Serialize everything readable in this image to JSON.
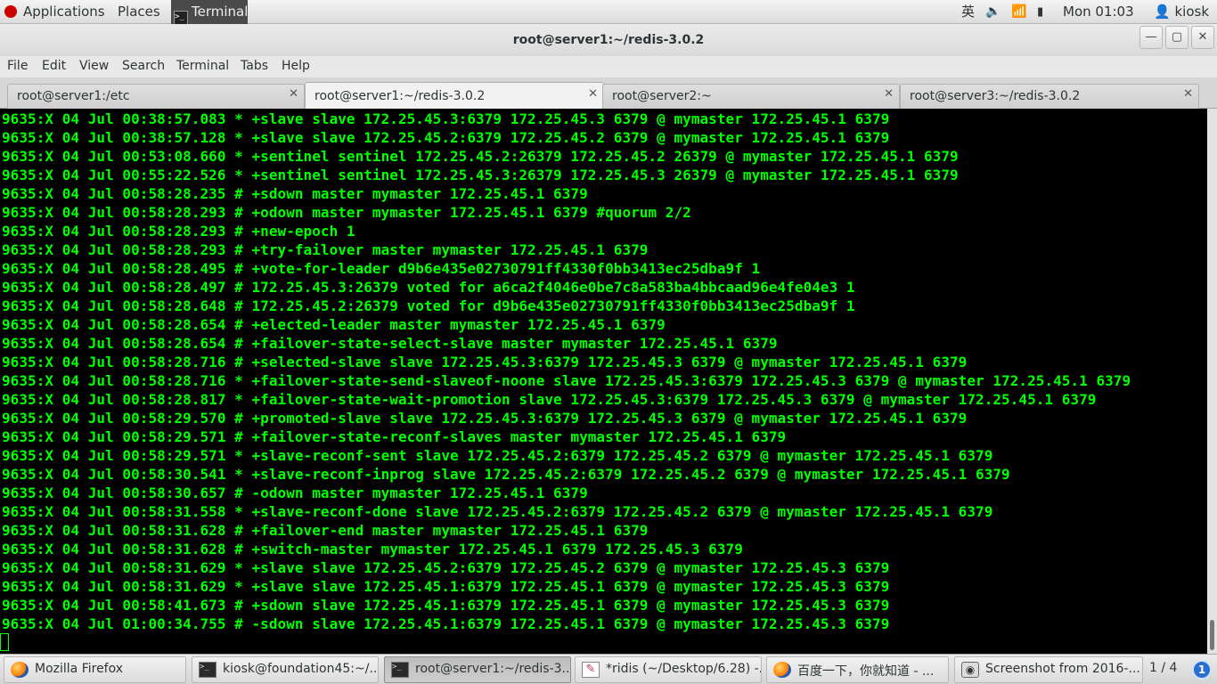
{
  "top_panel": {
    "applications": "Applications",
    "places": "Places",
    "terminal": "Terminal",
    "ime": "英",
    "clock": "Mon 01:03",
    "user": "kiosk"
  },
  "window": {
    "title": "root@server1:~/redis-3.0.2"
  },
  "menubar": {
    "file": "File",
    "edit": "Edit",
    "view": "View",
    "search": "Search",
    "terminal": "Terminal",
    "tabs": "Tabs",
    "help": "Help"
  },
  "tabs": [
    {
      "label": "root@server1:/etc",
      "active": false
    },
    {
      "label": "root@server1:~/redis-3.0.2",
      "active": true
    },
    {
      "label": "root@server2:~",
      "active": false
    },
    {
      "label": "root@server3:~/redis-3.0.2",
      "active": false
    }
  ],
  "terminal": {
    "lines": [
      "9635:X 04 Jul 00:38:57.083 * +slave slave 172.25.45.3:6379 172.25.45.3 6379 @ mymaster 172.25.45.1 6379",
      "9635:X 04 Jul 00:38:57.128 * +slave slave 172.25.45.2:6379 172.25.45.2 6379 @ mymaster 172.25.45.1 6379",
      "9635:X 04 Jul 00:53:08.660 * +sentinel sentinel 172.25.45.2:26379 172.25.45.2 26379 @ mymaster 172.25.45.1 6379",
      "9635:X 04 Jul 00:55:22.526 * +sentinel sentinel 172.25.45.3:26379 172.25.45.3 26379 @ mymaster 172.25.45.1 6379",
      "9635:X 04 Jul 00:58:28.235 # +sdown master mymaster 172.25.45.1 6379",
      "9635:X 04 Jul 00:58:28.293 # +odown master mymaster 172.25.45.1 6379 #quorum 2/2",
      "9635:X 04 Jul 00:58:28.293 # +new-epoch 1",
      "9635:X 04 Jul 00:58:28.293 # +try-failover master mymaster 172.25.45.1 6379",
      "9635:X 04 Jul 00:58:28.495 # +vote-for-leader d9b6e435e02730791ff4330f0bb3413ec25dba9f 1",
      "9635:X 04 Jul 00:58:28.497 # 172.25.45.3:26379 voted for a6ca2f4046e0be7c8a583ba4bbcaad96e4fe04e3 1",
      "9635:X 04 Jul 00:58:28.648 # 172.25.45.2:26379 voted for d9b6e435e02730791ff4330f0bb3413ec25dba9f 1",
      "9635:X 04 Jul 00:58:28.654 # +elected-leader master mymaster 172.25.45.1 6379",
      "9635:X 04 Jul 00:58:28.654 # +failover-state-select-slave master mymaster 172.25.45.1 6379",
      "9635:X 04 Jul 00:58:28.716 # +selected-slave slave 172.25.45.3:6379 172.25.45.3 6379 @ mymaster 172.25.45.1 6379",
      "9635:X 04 Jul 00:58:28.716 * +failover-state-send-slaveof-noone slave 172.25.45.3:6379 172.25.45.3 6379 @ mymaster 172.25.45.1 6379",
      "9635:X 04 Jul 00:58:28.817 * +failover-state-wait-promotion slave 172.25.45.3:6379 172.25.45.3 6379 @ mymaster 172.25.45.1 6379",
      "9635:X 04 Jul 00:58:29.570 # +promoted-slave slave 172.25.45.3:6379 172.25.45.3 6379 @ mymaster 172.25.45.1 6379",
      "9635:X 04 Jul 00:58:29.571 # +failover-state-reconf-slaves master mymaster 172.25.45.1 6379",
      "9635:X 04 Jul 00:58:29.571 * +slave-reconf-sent slave 172.25.45.2:6379 172.25.45.2 6379 @ mymaster 172.25.45.1 6379",
      "9635:X 04 Jul 00:58:30.541 * +slave-reconf-inprog slave 172.25.45.2:6379 172.25.45.2 6379 @ mymaster 172.25.45.1 6379",
      "9635:X 04 Jul 00:58:30.657 # -odown master mymaster 172.25.45.1 6379",
      "9635:X 04 Jul 00:58:31.558 * +slave-reconf-done slave 172.25.45.2:6379 172.25.45.2 6379 @ mymaster 172.25.45.1 6379",
      "9635:X 04 Jul 00:58:31.628 # +failover-end master mymaster 172.25.45.1 6379",
      "9635:X 04 Jul 00:58:31.628 # +switch-master mymaster 172.25.45.1 6379 172.25.45.3 6379",
      "9635:X 04 Jul 00:58:31.629 * +slave slave 172.25.45.2:6379 172.25.45.2 6379 @ mymaster 172.25.45.3 6379",
      "9635:X 04 Jul 00:58:31.629 * +slave slave 172.25.45.1:6379 172.25.45.1 6379 @ mymaster 172.25.45.3 6379",
      "9635:X 04 Jul 00:58:41.673 # +sdown slave 172.25.45.1:6379 172.25.45.1 6379 @ mymaster 172.25.45.3 6379",
      "9635:X 04 Jul 01:00:34.755 # -sdown slave 172.25.45.1:6379 172.25.45.1 6379 @ mymaster 172.25.45.3 6379"
    ],
    "text_color": "#00ff00",
    "background": "#000000"
  },
  "taskbar": {
    "tasks": [
      {
        "label": "Mozilla Firefox",
        "icon": "firefox-icon",
        "active": false
      },
      {
        "label": "kiosk@foundation45:~/...",
        "icon": "terminal-icon",
        "active": false
      },
      {
        "label": "root@server1:~/redis-3....",
        "icon": "terminal-icon",
        "active": true
      },
      {
        "label": "*ridis (~/Desktop/6.28) -...",
        "icon": "text-editor-icon",
        "active": false
      },
      {
        "label": "百度一下，你就知道 - ...",
        "icon": "firefox-icon",
        "active": false
      },
      {
        "label": "Screenshot from 2016-...",
        "icon": "screenshot-icon",
        "active": false
      }
    ],
    "workspace": "1 / 4",
    "notifications": "1"
  }
}
